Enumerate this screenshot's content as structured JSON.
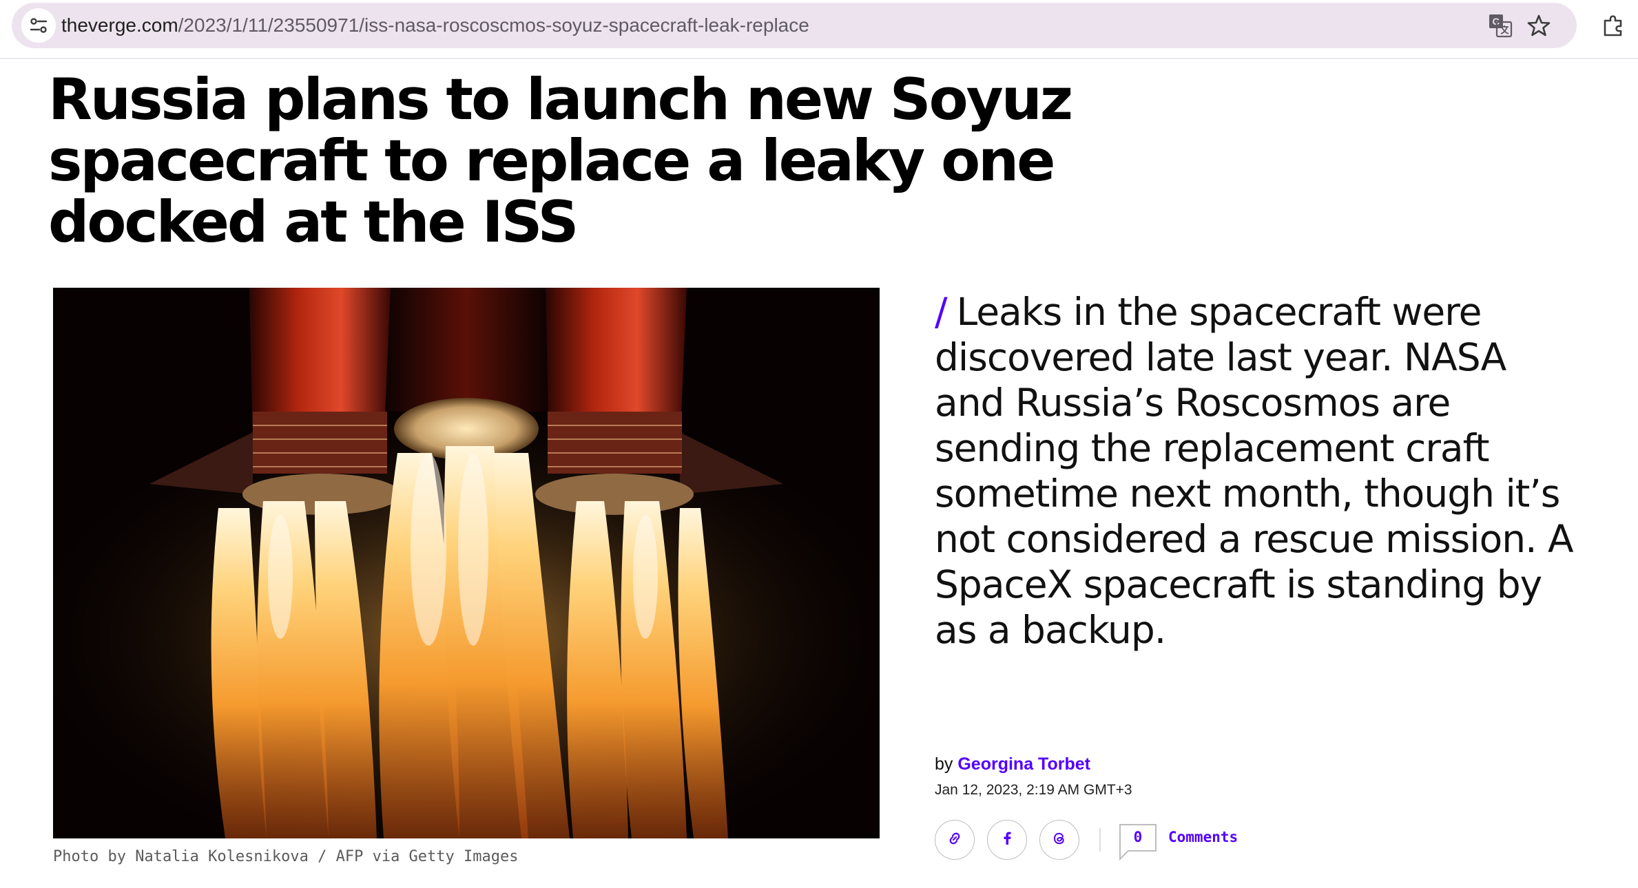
{
  "browser": {
    "url_host": "theverge.com",
    "url_path": "/2023/1/11/23550971/iss-nasa-roscoscmos-soyuz-spacecraft-leak-replace",
    "icons": [
      "site-info-icon",
      "translate-icon",
      "bookmark-star-icon",
      "extensions-icon"
    ]
  },
  "article": {
    "headline": "Russia plans to launch new Soyuz spacecraft to replace a leaky one docked at the ISS",
    "photo_credit": "Photo by Natalia Kolesnikova / AFP via Getty Images",
    "dek_slash": "/",
    "dek": "Leaks in the spacecraft were discovered late last year. NASA and Russia’s Roscosmos are sending the replacement craft sometime next month, though it’s not considered a rescue mission. A SpaceX spacecraft is standing by as a backup.",
    "byline_prefix": "by",
    "author": "Georgina Torbet",
    "date": "Jan 12, 2023, 2:19 AM GMT+3"
  },
  "share": {
    "icons": [
      "link-icon",
      "facebook-icon",
      "threads-icon"
    ],
    "comment_count": "0",
    "comments_label": "Comments"
  },
  "colors": {
    "accent": "#5200ff",
    "omnibox_bg": "#ede3ee"
  }
}
